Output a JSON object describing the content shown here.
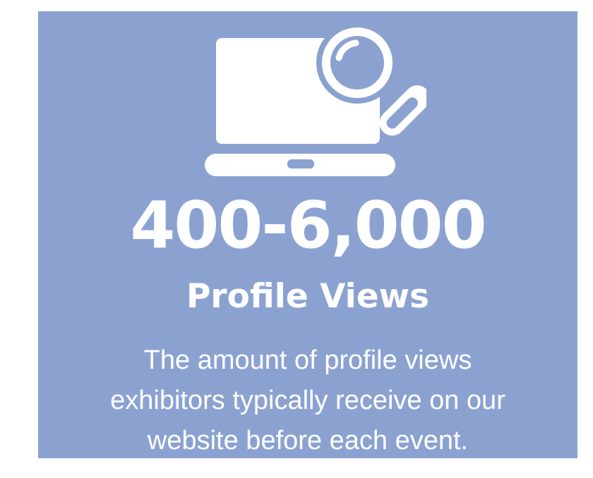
{
  "colors": {
    "card_background": "#8ba2d1",
    "foreground": "#ffffff"
  },
  "icon": {
    "name": "laptop-magnifier-icon"
  },
  "stat": {
    "value": "400-6,000",
    "label": "Profile Views"
  },
  "description": {
    "lines": [
      "The amount of profile views",
      "exhibitors typically receive on our",
      "website before each event."
    ]
  }
}
